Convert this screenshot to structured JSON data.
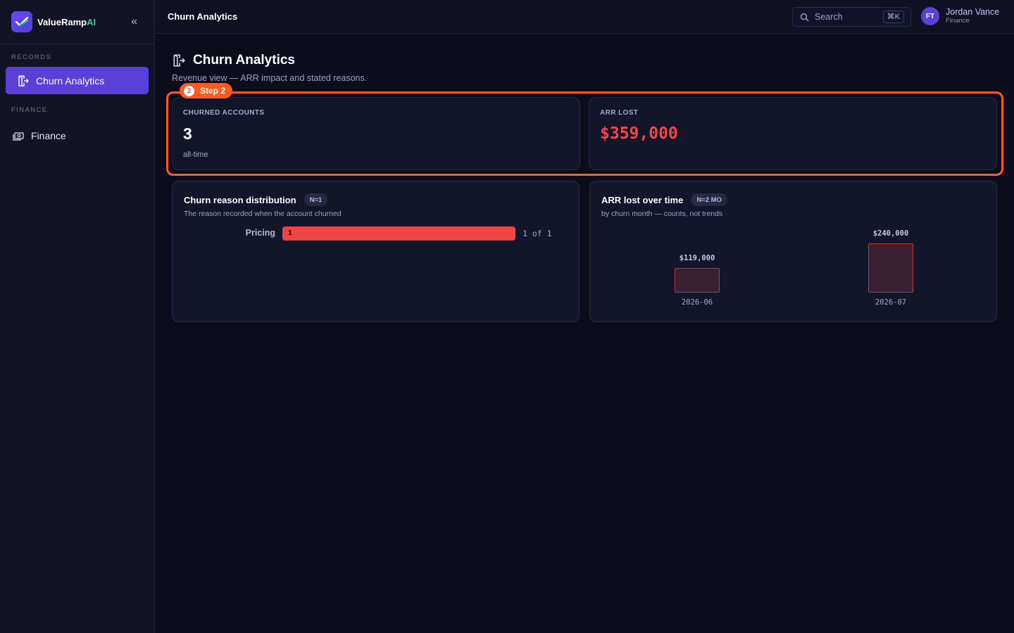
{
  "brand": {
    "name": "ValueRamp",
    "suffix": "AI",
    "accent": "#2fd38a"
  },
  "sidebar": {
    "sections": [
      {
        "label": "RECORDS",
        "items": [
          {
            "label": "Churn Analytics",
            "icon": "exit-door-icon",
            "active": true
          }
        ]
      },
      {
        "label": "FINANCE",
        "items": [
          {
            "label": "Finance",
            "icon": "cash-icon",
            "active": false
          }
        ]
      }
    ]
  },
  "topbar": {
    "title": "Churn Analytics",
    "search_placeholder": "Search",
    "search_shortcut": "⌘K",
    "user": {
      "initials": "FT",
      "name": "Jordan Vance",
      "role": "Finance"
    }
  },
  "page": {
    "title": "Churn Analytics",
    "subtitle": "Revenue view — ARR impact and stated reasons."
  },
  "step_badge": {
    "number": "2",
    "label": "Step 2",
    "color": "#ff5a1f"
  },
  "stats": {
    "churned": {
      "label": "CHURNED ACCOUNTS",
      "value": "3",
      "foot": "all-time"
    },
    "arr_lost": {
      "label": "ARR LOST",
      "value": "$359,000",
      "color": "#f04848"
    }
  },
  "reason_panel": {
    "title": "Churn reason distribution",
    "pill": "N=1",
    "subtitle": "The reason recorded when the account churned",
    "rows": [
      {
        "label": "Pricing",
        "count_label": "1",
        "fraction": 1.0,
        "of_label": "1 of 1"
      }
    ]
  },
  "arr_panel": {
    "title": "ARR lost over time",
    "pill": "N=2 MO",
    "subtitle": "by churn month — counts, not trends"
  },
  "chart_data": {
    "type": "bar",
    "categories": [
      "2026-06",
      "2026-07"
    ],
    "values": [
      119000,
      240000
    ],
    "value_labels": [
      "$119,000",
      "$240,000"
    ],
    "title": "ARR lost over time",
    "xlabel": "",
    "ylabel": "",
    "ylim": [
      0,
      240000
    ]
  }
}
